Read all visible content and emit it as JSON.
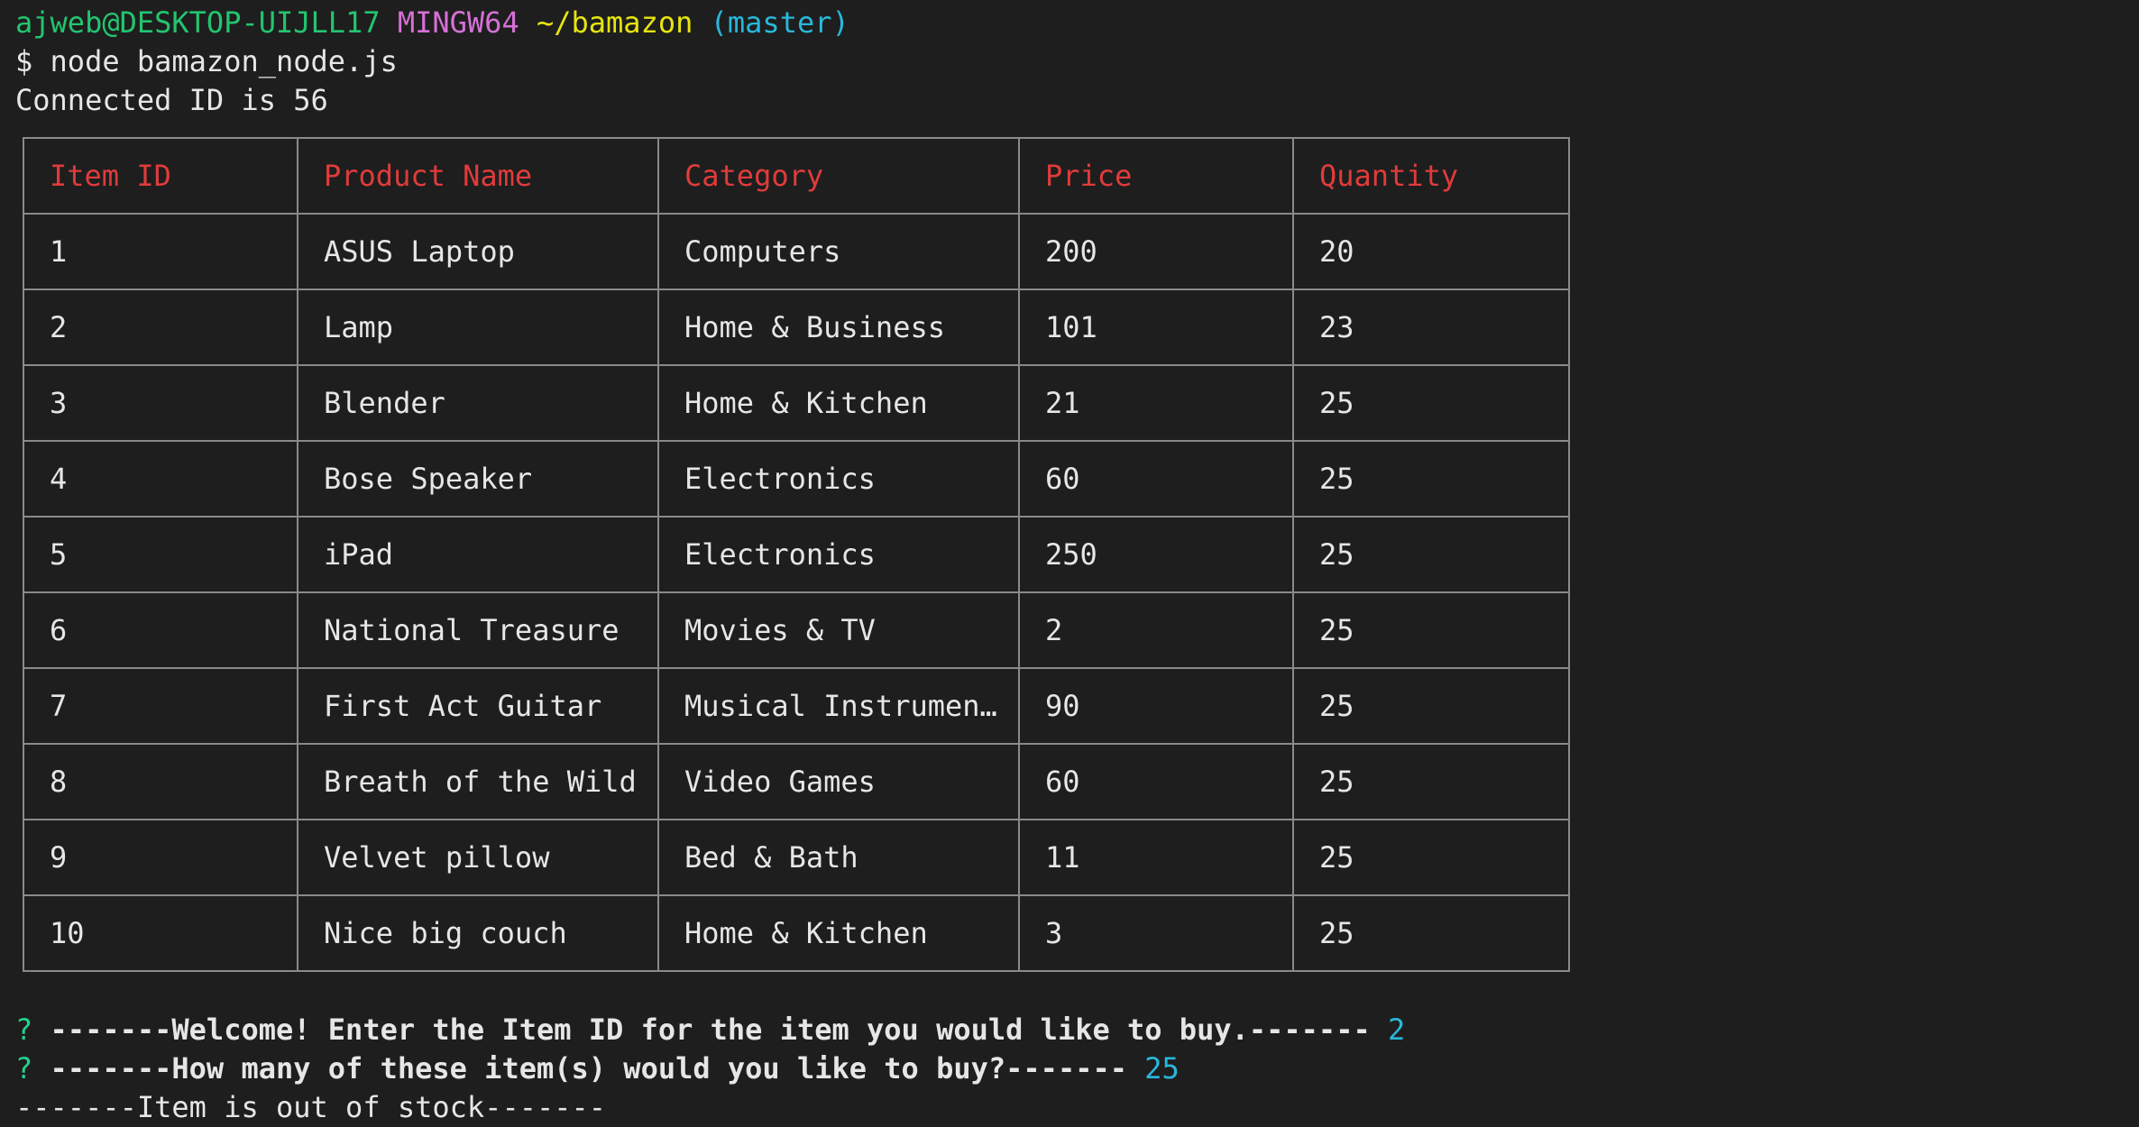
{
  "prompt": {
    "user_host": "ajweb@DESKTOP-UIJLL17",
    "env": "MINGW64",
    "path": "~/bamazon",
    "branch": "(master)"
  },
  "command": "$ node bamazon_node.js",
  "connected_msg": "Connected ID is 56",
  "table": {
    "headers": [
      "Item ID",
      "Product Name",
      "Category",
      "Price",
      "Quantity"
    ],
    "rows": [
      [
        "1",
        "ASUS Laptop",
        "Computers",
        "200",
        "20"
      ],
      [
        "2",
        "Lamp",
        "Home & Business",
        "101",
        "23"
      ],
      [
        "3",
        "Blender",
        "Home & Kitchen",
        "21",
        "25"
      ],
      [
        "4",
        "Bose Speaker",
        "Electronics",
        "60",
        "25"
      ],
      [
        "5",
        "iPad",
        "Electronics",
        "250",
        "25"
      ],
      [
        "6",
        "National Treasure",
        "Movies & TV",
        "2",
        "25"
      ],
      [
        "7",
        "First Act Guitar",
        "Musical Instrumen…",
        "90",
        "25"
      ],
      [
        "8",
        "Breath of the Wild",
        "Video Games",
        "60",
        "25"
      ],
      [
        "9",
        "Velvet pillow",
        "Bed & Bath",
        "11",
        "25"
      ],
      [
        "10",
        "Nice big couch",
        "Home & Kitchen",
        "3",
        "25"
      ]
    ]
  },
  "questions": [
    {
      "mark": "?",
      "text": "-------Welcome! Enter the Item ID for the item you would like to buy.-------",
      "answer": "2"
    },
    {
      "mark": "?",
      "text": "-------How many of these item(s) would you like to buy?-------",
      "answer": "25"
    }
  ],
  "result_msg": "-------Item is out of stock-------",
  "colors": {
    "background": "#1e1e1e",
    "header_text": "#e03b3b",
    "answer": "#29b8db",
    "question_mark": "#23d18b"
  }
}
